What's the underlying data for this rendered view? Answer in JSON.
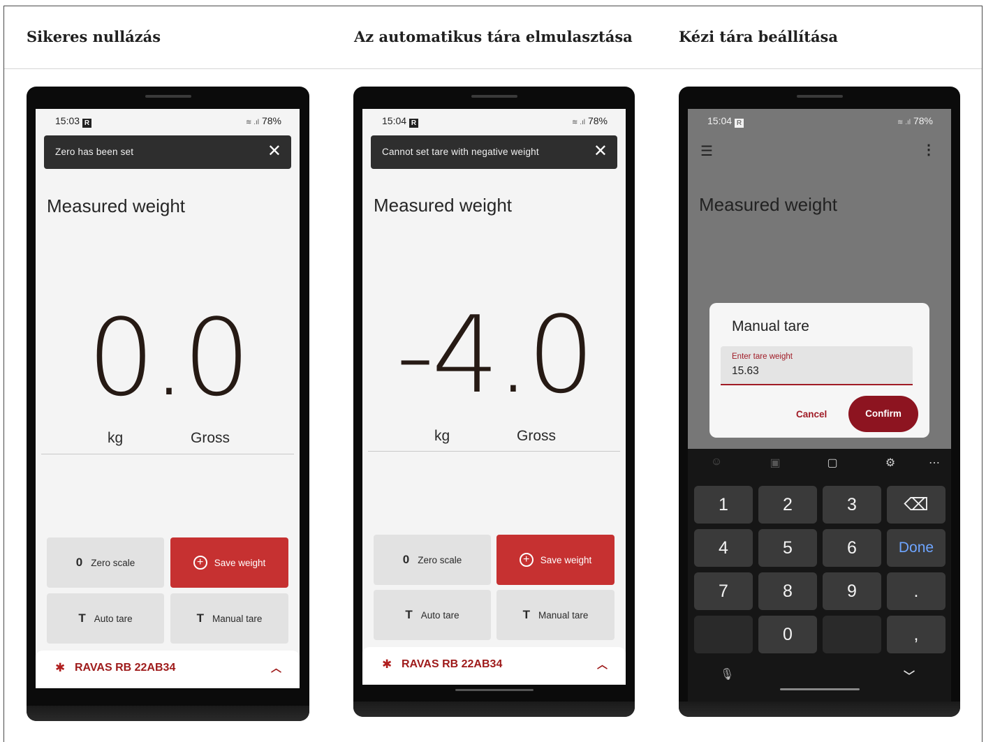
{
  "columns": [
    {
      "title": "Sikeres nullázás"
    },
    {
      "title": "Az automatikus tára elmulasztása"
    },
    {
      "title": "Kézi tára beállítása"
    }
  ],
  "phones": [
    {
      "status": {
        "time": "15:03",
        "badge": "R",
        "battery": "78%"
      },
      "snackbar": "Zero has been set",
      "title": "Measured weight",
      "value": "0.0",
      "unit": "kg",
      "mode": "Gross",
      "buttons": {
        "zero_icon": "0",
        "zero": "Zero scale",
        "save": "Save weight",
        "auto_icon": "T",
        "auto": "Auto tare",
        "manual_icon": "T",
        "manual": "Manual tare"
      },
      "device": "RAVAS RB 22AB34"
    },
    {
      "status": {
        "time": "15:04",
        "badge": "R",
        "battery": "78%"
      },
      "snackbar": "Cannot set tare with negative weight",
      "title": "Measured weight",
      "value": "-4.0",
      "unit": "kg",
      "mode": "Gross",
      "buttons": {
        "zero_icon": "0",
        "zero": "Zero scale",
        "save": "Save weight",
        "auto_icon": "T",
        "auto": "Auto tare",
        "manual_icon": "T",
        "manual": "Manual tare"
      },
      "device": "RAVAS RB 22AB34"
    },
    {
      "status": {
        "time": "15:04",
        "badge": "R",
        "battery": "78%"
      },
      "title": "Measured weight",
      "dialog": {
        "title": "Manual tare",
        "label": "Enter tare weight",
        "value": "15.63",
        "cancel": "Cancel",
        "confirm": "Confirm"
      },
      "keyboard": {
        "keys": [
          "1",
          "2",
          "3",
          "4",
          "5",
          "6",
          "Done",
          "7",
          "8",
          "9",
          ".",
          "0",
          ","
        ]
      }
    }
  ],
  "colors": {
    "accent_red": "#c63131",
    "brand_dark_red": "#8d1420",
    "done_blue": "#6ea5ff"
  },
  "icons": [
    "close-icon",
    "add-circle-icon",
    "bluetooth-icon",
    "chevron-up-icon",
    "menu-icon",
    "more-vert-icon",
    "backspace-icon",
    "mic-icon",
    "chevron-down-icon",
    "emoji-icon",
    "clipboard-icon",
    "settings-icon"
  ]
}
